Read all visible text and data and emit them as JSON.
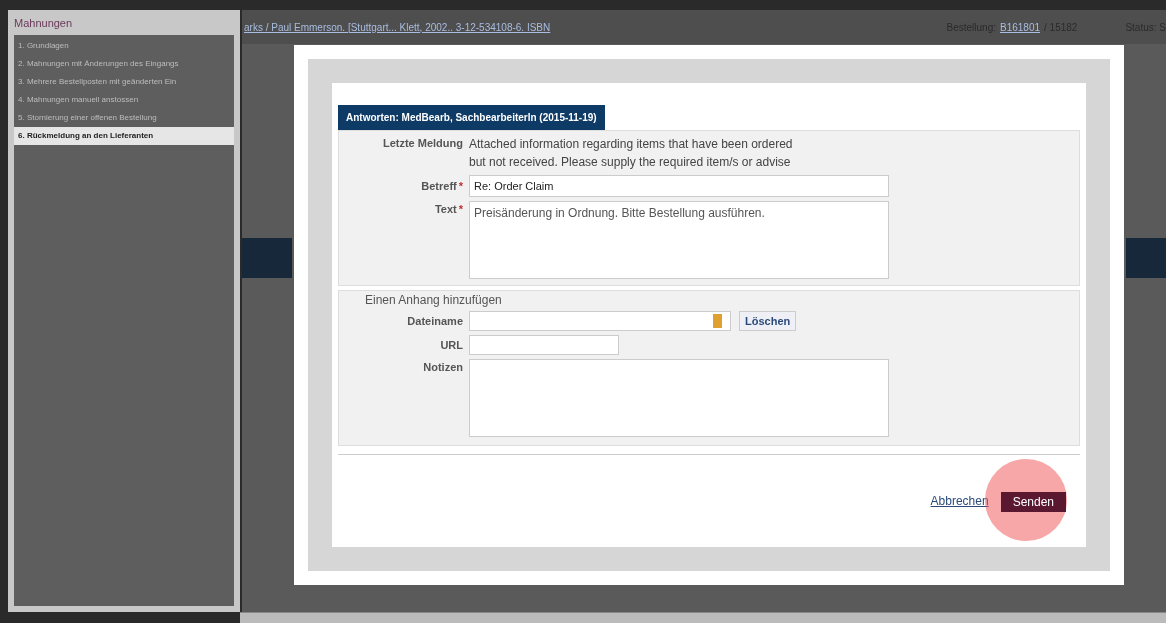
{
  "menu": {
    "title": "Mahnungen",
    "items": [
      {
        "label": "1. Grundlagen",
        "selected": false
      },
      {
        "label": "2. Mahnungen mit Änderungen des Eingangs",
        "selected": false
      },
      {
        "label": "3. Mehrere Bestellposten mit geänderten Ein",
        "selected": false
      },
      {
        "label": "4. Mahnungen manuell anstossen",
        "selected": false
      },
      {
        "label": "5. Stornierung einer offenen Bestellung",
        "selected": false
      },
      {
        "label": "6. Rückmeldung an den Lieferanten",
        "selected": true
      }
    ]
  },
  "background": {
    "title_link": "arks / Paul Emmerson. [Stuttgart... Klett, 2002.. 3-12-534108-6. ISBN",
    "order_label": "Bestellung:",
    "order_link": "B161801",
    "order_number": "/ 15182",
    "status": "Status: S"
  },
  "dialog": {
    "tab": "Antworten: MedBearb, SachbearbeiterIn (2015-11-19)",
    "last_message_label": "Letzte Meldung",
    "last_message": "Attached information regarding items that have been ordered but not received. Please supply the required item/s or advise",
    "subject_label": "Betreff",
    "subject": "Re: Order Claim",
    "text_label": "Text",
    "text": "Preisänderung in Ordnung. Bitte Bestellung ausführen.",
    "required_mark": "*",
    "attachment": {
      "legend": "Einen Anhang hinzufügen",
      "filename_label": "Dateiname",
      "delete_button": "Löschen",
      "url_label": "URL",
      "notes_label": "Notizen"
    },
    "cancel": "Abbrechen",
    "send": "Senden"
  }
}
